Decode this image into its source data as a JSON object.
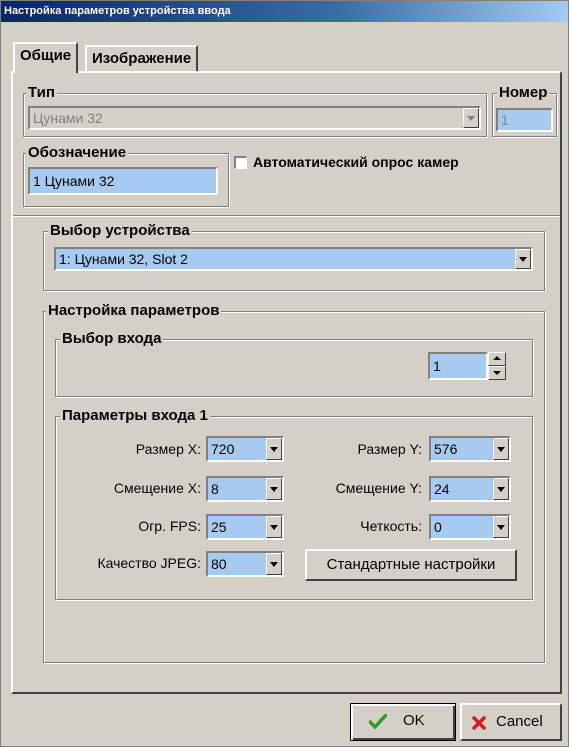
{
  "window": {
    "title": "Настройка параметров устройства ввода"
  },
  "tabs": [
    {
      "label": "Общие",
      "active": true
    },
    {
      "label": "Изображение",
      "active": false
    }
  ],
  "type_group": {
    "label": "Тип",
    "value": "Цунами 32"
  },
  "number_group": {
    "label": "Номер",
    "value": "1"
  },
  "designation_group": {
    "label": "Обозначение",
    "value": "1 Цунами 32"
  },
  "auto_poll": {
    "label": "Автоматический опрос камер",
    "checked": false
  },
  "device_select": {
    "label": "Выбор устройства",
    "value": "1: Цунами 32, Slot 2"
  },
  "params": {
    "label": "Настройка параметров",
    "input_select": {
      "label": "Выбор входа",
      "value": "1"
    },
    "input_params": {
      "label": "Параметры входа 1",
      "size_x": {
        "label": "Размер X:",
        "value": "720"
      },
      "size_y": {
        "label": "Размер Y:",
        "value": "576"
      },
      "offset_x": {
        "label": "Смещение X:",
        "value": "8"
      },
      "offset_y": {
        "label": "Смещение Y:",
        "value": "24"
      },
      "fps": {
        "label": "Огр. FPS:",
        "value": "25"
      },
      "sharpness": {
        "label": "Четкость:",
        "value": "0"
      },
      "jpeg": {
        "label": "Качество JPEG:",
        "value": "80"
      },
      "defaults_button": "Стандартные настройки"
    }
  },
  "footer": {
    "ok_label": "OK",
    "cancel_label": "Cancel"
  },
  "colors": {
    "field_bg": "#a6caf0",
    "window_bg": "#d4d0c8",
    "ok_check": "#2e9a2e",
    "cancel_x": "#cc2020"
  }
}
